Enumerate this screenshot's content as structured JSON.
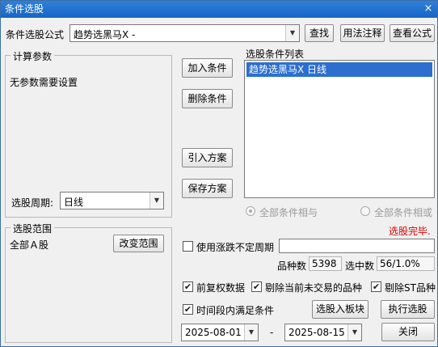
{
  "window": {
    "title": "条件选股",
    "close_glyph": "×"
  },
  "formula": {
    "label": "条件选股公式",
    "value": "趋势选黑马X  -",
    "find_label": "查找",
    "usage_label": "用法注释",
    "view_label": "查看公式"
  },
  "params": {
    "title": "计算参数",
    "message": "无参数需要设置",
    "period_label": "选股周期:",
    "period_value": "日线"
  },
  "actions": {
    "add_label": "加入条件",
    "delete_label": "删除条件",
    "import_label": "引入方案",
    "save_label": "保存方案"
  },
  "conditions": {
    "title": "选股条件列表",
    "items": [
      "趋势选黑马X  日线"
    ],
    "and_label": "全部条件相与",
    "or_label": "全部条件相或"
  },
  "status": {
    "text": "选股完毕.",
    "color": "#e00000"
  },
  "range": {
    "title": "选股范围",
    "value": "全部Ａ股",
    "change_label": "改变范围"
  },
  "options": {
    "irregular_label": "使用涨跌不定周期",
    "irregular_value": "",
    "count_label": "品种数",
    "count_value": "5398",
    "selected_label": "选中数",
    "selected_value": "56/1.0%",
    "fq_label": "前复权数据",
    "exclude_untraded_label": "剔除当前未交易的品种",
    "exclude_st_label": "剔除ST品种",
    "period_satisfy_label": "时间段内满足条件",
    "to_block_label": "选股入板块",
    "run_label": "执行选股",
    "start_date": "2025-08-01",
    "date_sep": "-",
    "end_date": "2025-08-15",
    "close_label": "关闭",
    "check_glyph": "✔"
  }
}
